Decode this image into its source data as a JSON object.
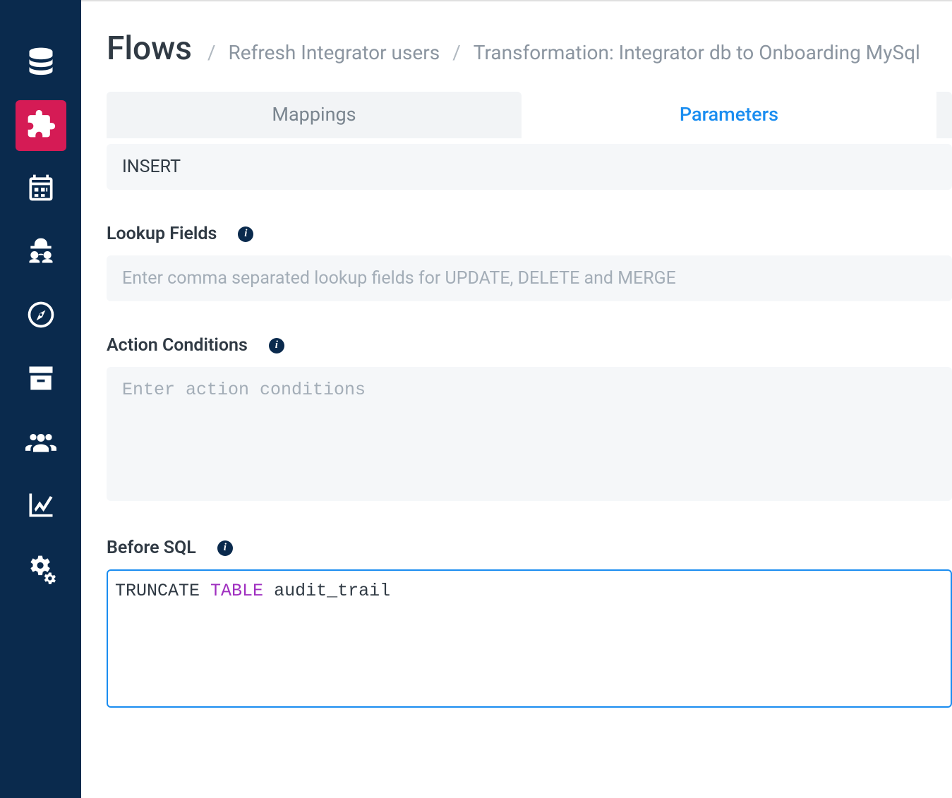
{
  "breadcrumb": {
    "title": "Flows",
    "crumb1": "Refresh Integrator users",
    "crumb2": "Transformation: Integrator db to Onboarding MySql"
  },
  "tabs": {
    "mappings": "Mappings",
    "parameters": "Parameters"
  },
  "fields": {
    "action_value": "INSERT",
    "lookup_label": "Lookup Fields",
    "lookup_placeholder": "Enter comma separated lookup fields for UPDATE, DELETE and MERGE",
    "lookup_value": "",
    "conditions_label": "Action Conditions",
    "conditions_placeholder": "Enter action conditions",
    "conditions_value": "",
    "before_sql_label": "Before SQL",
    "before_sql": {
      "tok1": "TRUNCATE",
      "tok2": "TABLE",
      "tok3": "audit_trail"
    }
  },
  "sidebar": {
    "items": [
      {
        "name": "database"
      },
      {
        "name": "puzzle",
        "active": true
      },
      {
        "name": "calendar"
      },
      {
        "name": "agent"
      },
      {
        "name": "compass"
      },
      {
        "name": "archive"
      },
      {
        "name": "users"
      },
      {
        "name": "chart"
      },
      {
        "name": "gears"
      }
    ]
  }
}
